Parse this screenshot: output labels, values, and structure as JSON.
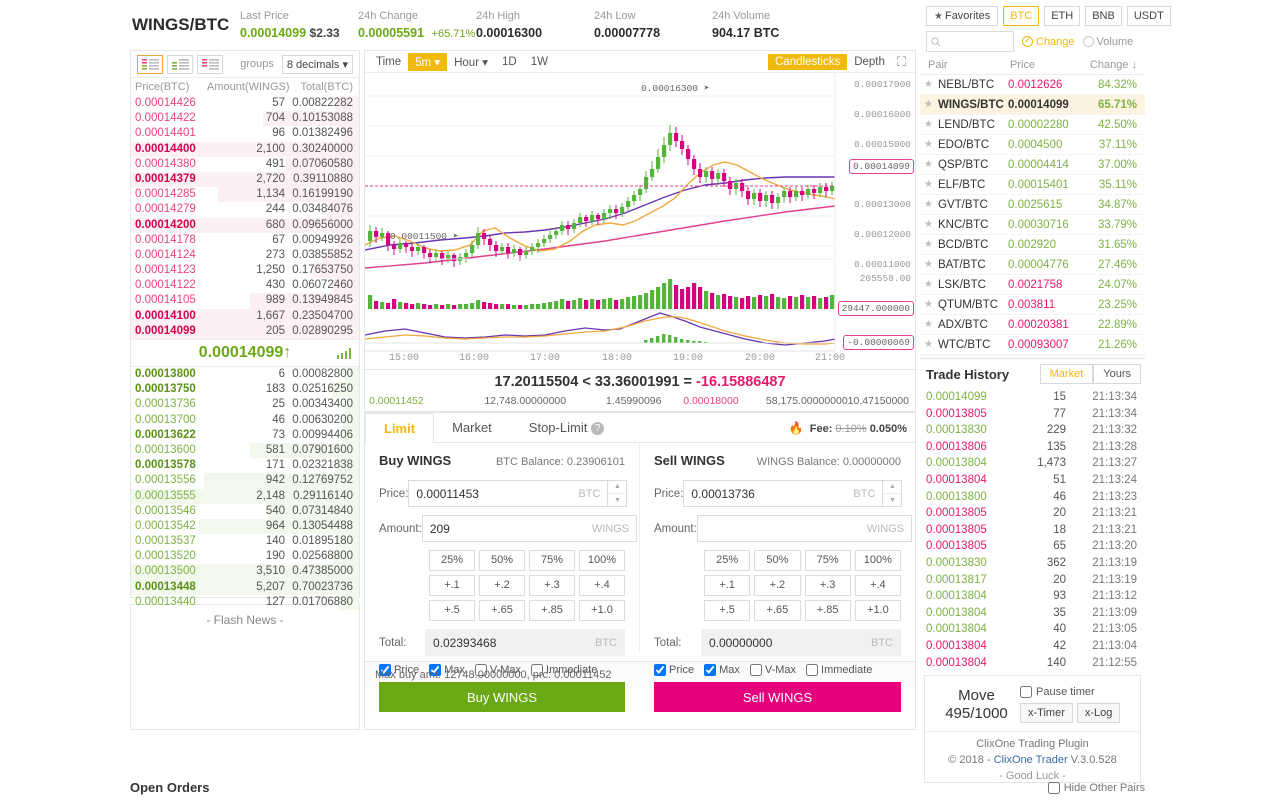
{
  "header": {
    "pair": "WINGS/BTC",
    "stats": [
      {
        "label": "Last Price",
        "value": "0.00014099",
        "sub": "$2.33",
        "color": "green"
      },
      {
        "label": "24h Change",
        "value": "0.00005591",
        "pct": "+65.71%",
        "color": "green"
      },
      {
        "label": "24h High",
        "value": "0.00016300",
        "color": "dark"
      },
      {
        "label": "24h Low",
        "value": "0.00007778",
        "color": "dark"
      },
      {
        "label": "24h Volume",
        "value": "904.17 BTC",
        "color": "dark"
      }
    ]
  },
  "orderbook": {
    "groups_label": "groups",
    "decimals": "8 decimals",
    "columns": [
      "Price(BTC)",
      "Amount(WINGS)",
      "Total(BTC)"
    ],
    "asks": [
      {
        "price": "0.00014426",
        "amount": "57",
        "total": "0.00822282",
        "bar": 10,
        "bold": false
      },
      {
        "price": "0.00014422",
        "amount": "704",
        "total": "0.10153088",
        "bar": 42,
        "bold": false
      },
      {
        "price": "0.00014401",
        "amount": "96",
        "total": "0.01382496",
        "bar": 8,
        "bold": false
      },
      {
        "price": "0.00014400",
        "amount": "2,100",
        "total": "0.30240000",
        "bar": 100,
        "bold": true
      },
      {
        "price": "0.00014380",
        "amount": "491",
        "total": "0.07060580",
        "bar": 32,
        "bold": false
      },
      {
        "price": "0.00014379",
        "amount": "2,720",
        "total": "0.39110880",
        "bar": 100,
        "bold": true
      },
      {
        "price": "0.00014285",
        "amount": "1,134",
        "total": "0.16199190",
        "bar": 62,
        "bold": false
      },
      {
        "price": "0.00014279",
        "amount": "244",
        "total": "0.03484076",
        "bar": 14,
        "bold": false
      },
      {
        "price": "0.00014200",
        "amount": "680",
        "total": "0.09656000",
        "bar": 100,
        "bold": true
      },
      {
        "price": "0.00014178",
        "amount": "67",
        "total": "0.00949926",
        "bar": 9,
        "bold": false
      },
      {
        "price": "0.00014124",
        "amount": "273",
        "total": "0.03855852",
        "bar": 16,
        "bold": false
      },
      {
        "price": "0.00014123",
        "amount": "1,250",
        "total": "0.17653750",
        "bar": 20,
        "bold": false
      },
      {
        "price": "0.00014122",
        "amount": "430",
        "total": "0.06072460",
        "bar": 12,
        "bold": false
      },
      {
        "price": "0.00014105",
        "amount": "989",
        "total": "0.13949845",
        "bar": 48,
        "bold": false
      },
      {
        "price": "0.00014100",
        "amount": "1,667",
        "total": "0.23504700",
        "bar": 100,
        "bold": true
      },
      {
        "price": "0.00014099",
        "amount": "205",
        "total": "0.02890295",
        "bar": 100,
        "bold": true
      }
    ],
    "spread_price": "0.00014099",
    "spread_arrow": "↑",
    "bids": [
      {
        "price": "0.00013800",
        "amount": "6",
        "total": "0.00082800",
        "bar": 6,
        "bold": true
      },
      {
        "price": "0.00013750",
        "amount": "183",
        "total": "0.02516250",
        "bar": 12,
        "bold": true
      },
      {
        "price": "0.00013736",
        "amount": "25",
        "total": "0.00343400",
        "bar": 6,
        "bold": false
      },
      {
        "price": "0.00013700",
        "amount": "46",
        "total": "0.00630200",
        "bar": 7,
        "bold": false
      },
      {
        "price": "0.00013622",
        "amount": "73",
        "total": "0.00994406",
        "bar": 8,
        "bold": true
      },
      {
        "price": "0.00013600",
        "amount": "581",
        "total": "0.07901600",
        "bar": 48,
        "bold": false
      },
      {
        "price": "0.00013578",
        "amount": "171",
        "total": "0.02321838",
        "bar": 10,
        "bold": true
      },
      {
        "price": "0.00013556",
        "amount": "942",
        "total": "0.12769752",
        "bar": 68,
        "bold": false
      },
      {
        "price": "0.00013555",
        "amount": "2,148",
        "total": "0.29116140",
        "bar": 100,
        "bold": false
      },
      {
        "price": "0.00013546",
        "amount": "540",
        "total": "0.07314840",
        "bar": 40,
        "bold": false
      },
      {
        "price": "0.00013542",
        "amount": "964",
        "total": "0.13054488",
        "bar": 70,
        "bold": false
      },
      {
        "price": "0.00013537",
        "amount": "140",
        "total": "0.01895180",
        "bar": 10,
        "bold": false
      },
      {
        "price": "0.00013520",
        "amount": "190",
        "total": "0.02568800",
        "bar": 12,
        "bold": false
      },
      {
        "price": "0.00013500",
        "amount": "3,510",
        "total": "0.47385000",
        "bar": 100,
        "bold": false
      },
      {
        "price": "0.00013448",
        "amount": "5,207",
        "total": "0.70023736",
        "bar": 100,
        "bold": true
      },
      {
        "price": "0.00013440",
        "amount": "127",
        "total": "0.01706880",
        "bar": 9,
        "bold": false
      }
    ]
  },
  "flash_news": {
    "text": "- Flash News -"
  },
  "chart": {
    "toolbar": {
      "time_label": "Time",
      "interval": "5m",
      "hour": "Hour",
      "day": "1D",
      "week": "1W",
      "candlesticks": "Candlesticks",
      "depth": "Depth"
    },
    "annotations": {
      "high": "0.00016300",
      "low": "0.00011500",
      "current_price_tag": "0.00014099",
      "volume_tag": "29447.000000",
      "volume_axis": "205558.00",
      "macd_tag": "-0.00000069"
    },
    "y_ticks": [
      "0.00017000",
      "0.00016000",
      "0.00015000",
      "0.00013000",
      "0.00012000",
      "0.00011000"
    ],
    "x_ticks": [
      "15:00",
      "16:00",
      "17:00",
      "18:00",
      "19:00",
      "20:00",
      "21:00"
    ]
  },
  "calc": {
    "expression_a": "17.20115504",
    "operator": "<",
    "expression_b": "33.36001991",
    "equals": "=",
    "result": "-16.15886487",
    "row": [
      "0.00011452",
      "12,748.00000000",
      "1.45990096",
      "0.00018000",
      "58,175.00000000",
      "10.47150000"
    ]
  },
  "trade_form": {
    "tabs": [
      {
        "label": "Limit",
        "active": true
      },
      {
        "label": "Market",
        "active": false
      },
      {
        "label": "Stop-Limit",
        "active": false,
        "help": "?"
      }
    ],
    "fee_label": "Fee:",
    "fee_old": "0.10%",
    "fee_new": "0.050%",
    "buy": {
      "title": "Buy WINGS",
      "balance": "BTC Balance: 0.23906101",
      "price_label": "Price:",
      "price_value": "0.00011453",
      "price_unit": "BTC",
      "amount_label": "Amount:",
      "amount_value": "209",
      "amount_unit": "WINGS",
      "pct_buttons": [
        "25%",
        "50%",
        "75%",
        "100%"
      ],
      "inc_row1": [
        "+.1",
        "+.2",
        "+.3",
        "+.4"
      ],
      "inc_row2": [
        "+.5",
        "+.65",
        "+.85",
        "+1.0"
      ],
      "total_label": "Total:",
      "total_value": "0.02393468",
      "total_unit": "BTC",
      "checks": [
        {
          "label": "Price",
          "checked": true
        },
        {
          "label": "Max",
          "checked": true
        },
        {
          "label": "V-Max",
          "checked": false
        },
        {
          "label": "Immediate",
          "checked": false
        }
      ],
      "submit": "Buy WINGS"
    },
    "sell": {
      "title": "Sell WINGS",
      "balance": "WINGS Balance: 0.00000000",
      "price_label": "Price:",
      "price_value": "0.00013736",
      "price_unit": "BTC",
      "amount_label": "Amount:",
      "amount_value": "",
      "amount_unit": "WINGS",
      "pct_buttons": [
        "25%",
        "50%",
        "75%",
        "100%"
      ],
      "inc_row1": [
        "+.1",
        "+.2",
        "+.3",
        "+.4"
      ],
      "inc_row2": [
        "+.5",
        "+.65",
        "+.85",
        "+1.0"
      ],
      "total_label": "Total:",
      "total_value": "0.00000000",
      "total_unit": "BTC",
      "checks": [
        {
          "label": "Price",
          "checked": true
        },
        {
          "label": "Max",
          "checked": true
        },
        {
          "label": "V-Max",
          "checked": false
        },
        {
          "label": "Immediate",
          "checked": false
        }
      ],
      "submit": "Sell WINGS"
    },
    "footer": "Max buy amt: 12748.00000000, prc: 0.00011452"
  },
  "sidebar": {
    "favorites_label": "Favorites",
    "markets": [
      {
        "label": "BTC",
        "active": true
      },
      {
        "label": "ETH",
        "active": false
      },
      {
        "label": "BNB",
        "active": false
      },
      {
        "label": "USDT",
        "active": false
      }
    ],
    "search_placeholder": "",
    "sort_change": "Change",
    "sort_volume": "Volume",
    "sort_active": "Change",
    "columns": [
      "Pair",
      "Price",
      "Change ↓"
    ],
    "pairs": [
      {
        "name": "NEBL/BTC",
        "price": "0.0012626",
        "price_dir": "down",
        "change": "84.32%",
        "selected": false
      },
      {
        "name": "WINGS/BTC",
        "price": "0.00014099",
        "price_dir": "dark",
        "change": "65.71%",
        "selected": true
      },
      {
        "name": "LEND/BTC",
        "price": "0.00002280",
        "price_dir": "up",
        "change": "42.50%",
        "selected": false
      },
      {
        "name": "EDO/BTC",
        "price": "0.0004500",
        "price_dir": "up",
        "change": "37.11%",
        "selected": false
      },
      {
        "name": "QSP/BTC",
        "price": "0.00004414",
        "price_dir": "up",
        "change": "37.00%",
        "selected": false
      },
      {
        "name": "ELF/BTC",
        "price": "0.00015401",
        "price_dir": "up",
        "change": "35.11%",
        "selected": false
      },
      {
        "name": "GVT/BTC",
        "price": "0.0025615",
        "price_dir": "up",
        "change": "34.87%",
        "selected": false
      },
      {
        "name": "KNC/BTC",
        "price": "0.00030716",
        "price_dir": "up",
        "change": "33.79%",
        "selected": false
      },
      {
        "name": "BCD/BTC",
        "price": "0.002920",
        "price_dir": "up",
        "change": "31.65%",
        "selected": false
      },
      {
        "name": "BAT/BTC",
        "price": "0.00004776",
        "price_dir": "up",
        "change": "27.46%",
        "selected": false
      },
      {
        "name": "LSK/BTC",
        "price": "0.0021758",
        "price_dir": "down",
        "change": "24.07%",
        "selected": false
      },
      {
        "name": "QTUM/BTC",
        "price": "0.003811",
        "price_dir": "down",
        "change": "23.25%",
        "selected": false
      },
      {
        "name": "ADX/BTC",
        "price": "0.00020381",
        "price_dir": "down",
        "change": "22.89%",
        "selected": false
      },
      {
        "name": "WTC/BTC",
        "price": "0.00093007",
        "price_dir": "down",
        "change": "21.26%",
        "selected": false
      }
    ]
  },
  "trade_history": {
    "title": "Trade History",
    "tabs": [
      {
        "label": "Market",
        "active": true
      },
      {
        "label": "Yours",
        "active": false
      }
    ],
    "rows": [
      {
        "price": "0.00014099",
        "dir": "up",
        "amount": "15",
        "time": "21:13:34"
      },
      {
        "price": "0.00013805",
        "dir": "down",
        "amount": "77",
        "time": "21:13:34"
      },
      {
        "price": "0.00013830",
        "dir": "up",
        "amount": "229",
        "time": "21:13:32"
      },
      {
        "price": "0.00013806",
        "dir": "down",
        "amount": "135",
        "time": "21:13:28"
      },
      {
        "price": "0.00013804",
        "dir": "up",
        "amount": "1,473",
        "time": "21:13:27"
      },
      {
        "price": "0.00013804",
        "dir": "down",
        "amount": "51",
        "time": "21:13:24"
      },
      {
        "price": "0.00013800",
        "dir": "up",
        "amount": "46",
        "time": "21:13:23"
      },
      {
        "price": "0.00013805",
        "dir": "down",
        "amount": "20",
        "time": "21:13:21"
      },
      {
        "price": "0.00013805",
        "dir": "down",
        "amount": "18",
        "time": "21:13:21"
      },
      {
        "price": "0.00013805",
        "dir": "down",
        "amount": "65",
        "time": "21:13:20"
      },
      {
        "price": "0.00013830",
        "dir": "up",
        "amount": "362",
        "time": "21:13:19"
      },
      {
        "price": "0.00013817",
        "dir": "up",
        "amount": "20",
        "time": "21:13:19"
      },
      {
        "price": "0.00013804",
        "dir": "up",
        "amount": "93",
        "time": "21:13:12"
      },
      {
        "price": "0.00013804",
        "dir": "up",
        "amount": "35",
        "time": "21:13:09"
      },
      {
        "price": "0.00013804",
        "dir": "up",
        "amount": "40",
        "time": "21:13:05"
      },
      {
        "price": "0.00013804",
        "dir": "down",
        "amount": "42",
        "time": "21:13:04"
      },
      {
        "price": "0.00013804",
        "dir": "down",
        "amount": "140",
        "time": "21:12:55"
      }
    ]
  },
  "move_panel": {
    "move_label": "Move",
    "move_count": "495/1000",
    "pause_label": "Pause timer",
    "timer_button": "x-Timer",
    "log_button": "x-Log",
    "plugin_name": "ClixOne Trading Plugin",
    "copyright": "© 2018 -",
    "link": "ClixOne Trader",
    "version": "V.3.0.528",
    "good_luck": "- Good Luck -"
  },
  "open_orders": {
    "title": "Open Orders",
    "hide_label": "Hide Other Pairs"
  },
  "colors": {
    "green": "#6aa815",
    "pink": "#e6007e",
    "amber": "#f0b90b",
    "ask": "#e8447f",
    "bid": "#7cb342"
  }
}
